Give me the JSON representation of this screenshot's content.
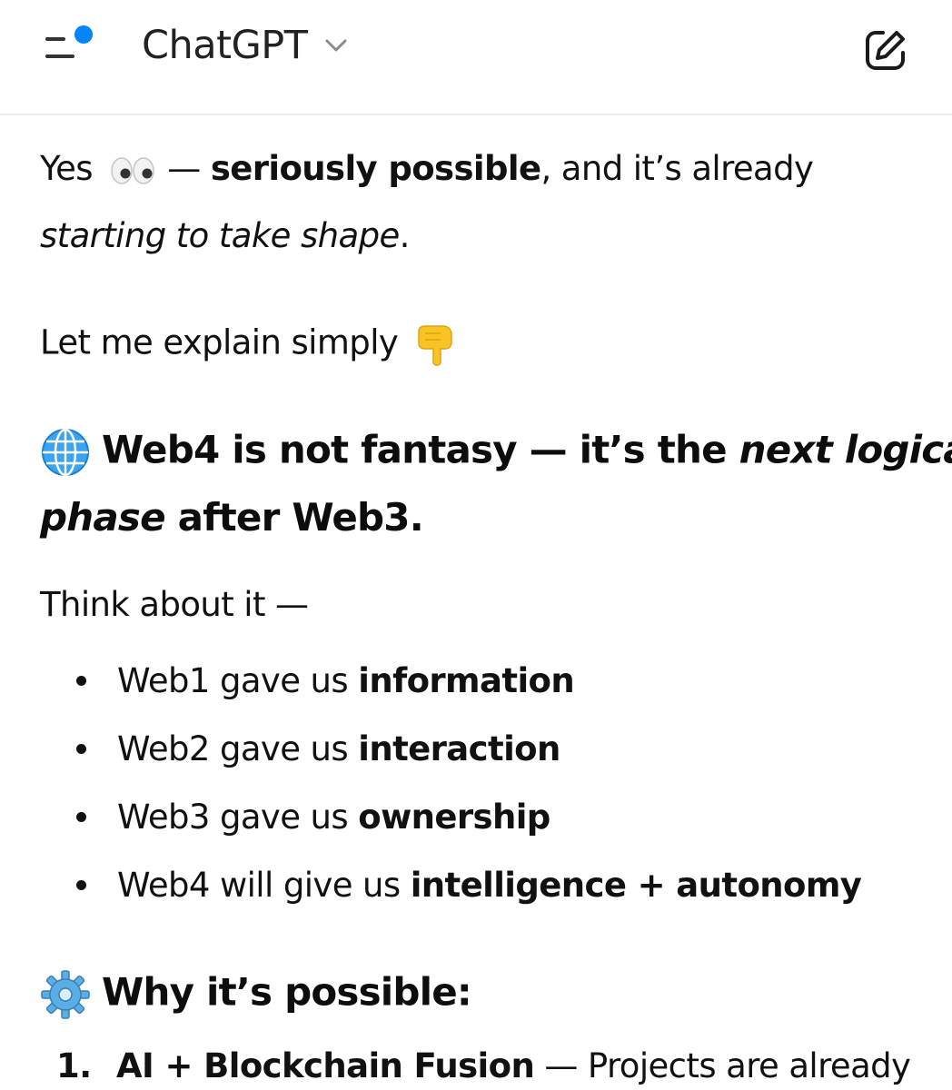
{
  "header": {
    "title": "ChatGPT",
    "icons": {
      "menu": "menu-icon",
      "notification_dot": "notification-dot-icon",
      "chevron": "chevron-down-icon",
      "new_chat": "new-chat-edit-icon"
    },
    "accent_color": "#0285ff"
  },
  "message": {
    "intro": {
      "yes": "Yes",
      "dash": " — ",
      "seriously_possible": "seriously possible",
      "and_already": ", and it’s already",
      "shape": "starting to take shape",
      "period": ".",
      "eyes_emoji": "eyes-emoji"
    },
    "explain": {
      "text": "Let me explain simply",
      "emoji": "pointing-down-emoji"
    },
    "heading1": {
      "emoji": "globe-emoji",
      "part1": "Web4 is not fantasy — it’s the ",
      "next_logical": "next logical",
      "phase": "phase",
      "part2": " after Web3."
    },
    "think": "Think about it —",
    "bullets": [
      {
        "prefix": "Web1 gave us ",
        "bold": "information"
      },
      {
        "prefix": "Web2 gave us ",
        "bold": "interaction"
      },
      {
        "prefix": "Web3 gave us ",
        "bold": "ownership"
      },
      {
        "prefix": "Web4 will give us ",
        "bold": "intelligence + autonomy"
      }
    ],
    "heading2": {
      "emoji": "gear-emoji",
      "text": "Why it’s possible:"
    },
    "numbered": [
      {
        "num": "1.",
        "bold": "AI + Blockchain Fusion",
        "rest": " — Projects are already"
      }
    ]
  }
}
